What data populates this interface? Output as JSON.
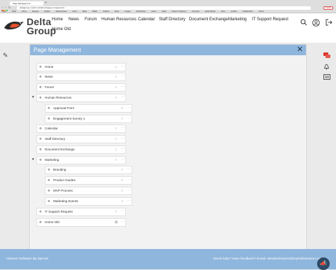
{
  "browser": {
    "tab_title": "Page Management",
    "url": "deltagroup.myhub.net/admin/page-management",
    "update_label": "Update",
    "bookmarks": [
      "Apps",
      "Delta",
      "Home",
      "Recipes",
      "MyHub",
      "Shared drives",
      "Inbox",
      "Bank",
      "Wallet",
      "Outlook",
      "Drive",
      "Images",
      "Work/online",
      "Cloud",
      "Tasks",
      "Project & Delivery",
      "Accounts",
      "Delta MyHub",
      "Docs",
      "Ansible",
      "Collaboration",
      "Admin"
    ]
  },
  "header": {
    "brand_line1": "Delta",
    "brand_line2": "Group",
    "nav": [
      "Home",
      "News",
      "Forum",
      "Human Resources",
      "Calendar",
      "Staff Directory",
      "Document Exchange",
      "Marketing",
      "IT Support Request",
      "Home Old"
    ]
  },
  "panel": {
    "title": "Page Management",
    "items": [
      {
        "label": "Home",
        "level": 0,
        "home_icon": true
      },
      {
        "label": "News",
        "level": 0
      },
      {
        "label": "Forum",
        "level": 0
      },
      {
        "label": "Human Resources",
        "level": 0,
        "expanded": true
      },
      {
        "label": "Approval Form",
        "level": 1
      },
      {
        "label": "Engagement Survey 1",
        "level": 1
      },
      {
        "label": "Calendar",
        "level": 0
      },
      {
        "label": "Staff Directory",
        "level": 0
      },
      {
        "label": "Document Exchange",
        "level": 0
      },
      {
        "label": "Marketing",
        "level": 0,
        "expanded": true
      },
      {
        "label": "Branding",
        "level": 1
      },
      {
        "label": "Product Guides",
        "level": 1
      },
      {
        "label": "MVP Process",
        "level": 1
      },
      {
        "label": "Marketing Events",
        "level": 1
      },
      {
        "label": "IT Support Request",
        "level": 0
      },
      {
        "label": "Home Old",
        "level": 0,
        "hidden_icon": true
      }
    ]
  },
  "footer": {
    "left": "Intranet Software By MyHub",
    "right": "Need help? Have feedback? Email: siteadminname@myhubintranet.com"
  },
  "colors": {
    "accent": "#8fb6dd",
    "brand_red": "#d9534f"
  }
}
